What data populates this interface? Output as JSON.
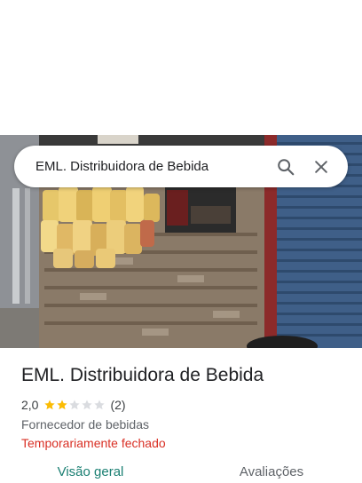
{
  "search": {
    "query": "EML. Distribuidora de Bebida"
  },
  "icons": {
    "search": "search-icon",
    "close": "close-icon",
    "star": "star-icon"
  },
  "place": {
    "title": "EML. Distribuidora de Bebida",
    "rating": "2,0",
    "rating_value": 2,
    "rating_max": 5,
    "review_count": "(2)",
    "category": "Fornecedor de bebidas",
    "status": "Temporariamente fechado"
  },
  "tabs": [
    {
      "label": "Visão geral",
      "active": true
    },
    {
      "label": "Avaliações",
      "active": false
    }
  ],
  "colors": {
    "star_filled": "#fbbc04",
    "star_empty": "#dadce0",
    "status_closed": "#d93025",
    "tab_active": "#1a7f72"
  }
}
